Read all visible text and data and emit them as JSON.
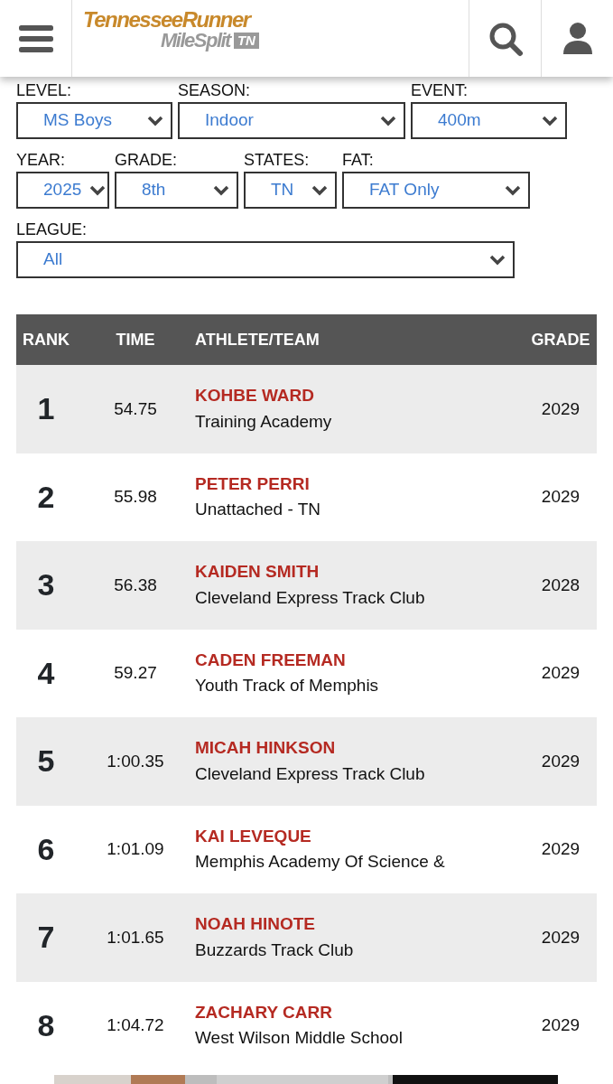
{
  "header": {
    "logo": {
      "line_1": "TennesseeRunner",
      "line_2": "MileSplit",
      "badge": "TN"
    }
  },
  "filters": [
    {
      "label": "LEVEL:",
      "value": "MS Boys"
    },
    {
      "label": "SEASON:",
      "value": "Indoor"
    },
    {
      "label": "EVENT:",
      "value": "400m"
    },
    {
      "label": "YEAR:",
      "value": "2025"
    },
    {
      "label": "GRADE:",
      "value": "8th"
    },
    {
      "label": "STATES:",
      "value": "TN"
    },
    {
      "label": "FAT:",
      "value": "FAT Only"
    },
    {
      "label": "LEAGUE:",
      "value": "All"
    }
  ],
  "table": {
    "columns": [
      "RANK",
      "TIME",
      "ATHLETE/TEAM",
      "GRADE"
    ],
    "rows": [
      {
        "rank": "1",
        "time": "54.75",
        "athlete": "KOHBE WARD",
        "team": "Training Academy",
        "grade": "2029"
      },
      {
        "rank": "2",
        "time": "55.98",
        "athlete": "PETER PERRI",
        "team": "Unattached - TN",
        "grade": "2029"
      },
      {
        "rank": "3",
        "time": "56.38",
        "athlete": "KAIDEN SMITH",
        "team": "Cleveland Express Track Club",
        "grade": "2028"
      },
      {
        "rank": "4",
        "time": "59.27",
        "athlete": "CADEN FREEMAN",
        "team": "Youth Track of Memphis",
        "grade": "2029"
      },
      {
        "rank": "5",
        "time": "1:00.35",
        "athlete": "MICAH HINKSON",
        "team": "Cleveland Express Track Club",
        "grade": "2029"
      },
      {
        "rank": "6",
        "time": "1:01.09",
        "athlete": "KAI LEVEQUE",
        "team": "Memphis Academy Of Science &",
        "grade": "2029"
      },
      {
        "rank": "7",
        "time": "1:01.65",
        "athlete": "NOAH HINOTE",
        "team": "Buzzards Track Club",
        "grade": "2029"
      },
      {
        "rank": "8",
        "time": "1:04.72",
        "athlete": "ZACHARY CARR",
        "team": "West Wilson Middle School",
        "grade": "2029"
      }
    ]
  }
}
